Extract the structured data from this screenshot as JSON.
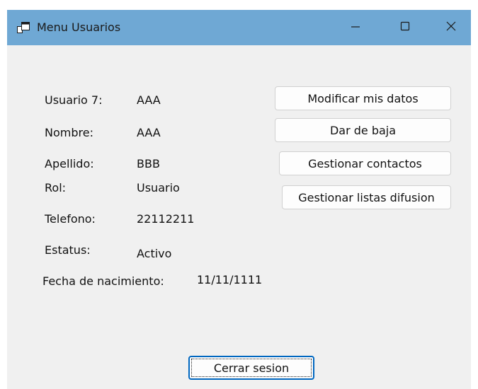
{
  "window": {
    "title": "Menu Usuarios",
    "titlebar_color": "#6fa8d4",
    "icons": {
      "app": "app-window-icon",
      "minimize": "minimize-icon",
      "maximize": "maximize-icon",
      "close": "close-icon"
    }
  },
  "fields": {
    "usuario": {
      "label": "Usuario 7:",
      "value": "AAA"
    },
    "nombre": {
      "label": "Nombre:",
      "value": "AAA"
    },
    "apellido": {
      "label": "Apellido:",
      "value": "BBB"
    },
    "rol": {
      "label": "Rol:",
      "value": "Usuario"
    },
    "telefono": {
      "label": "Telefono:",
      "value": "22112211"
    },
    "estatus": {
      "label": "Estatus:",
      "value": "Activo"
    },
    "fecha_nacimiento": {
      "label": "Fecha de nacimiento:",
      "value": "11/11/1111"
    }
  },
  "actions": {
    "modificar": "Modificar mis datos",
    "baja": "Dar de baja",
    "contactos": "Gestionar contactos",
    "listas": "Gestionar listas difusion",
    "cerrar_sesion": "Cerrar sesion"
  }
}
